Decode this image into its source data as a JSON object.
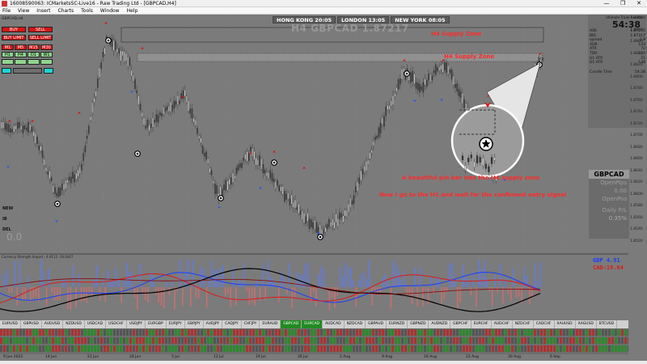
{
  "window": {
    "title": "16008590063: ICMarketsSC-Live16 - Raw Trading Ltd - [GBPCAD,H4]",
    "controls": [
      "—",
      "❐",
      "✕"
    ]
  },
  "menu": [
    "File",
    "View",
    "Insert",
    "Charts",
    "Tools",
    "Window",
    "Help"
  ],
  "chart": {
    "symbol_tf": "GBPCAD,H4",
    "watermark": "H4 GBPCAD 1.87217",
    "sessions": [
      {
        "label": "HONG KONG 20:05"
      },
      {
        "label": "LONDON 13:05"
      },
      {
        "label": "NEW YORK 08:05"
      }
    ],
    "annotations": {
      "zone_top": "H4 Supply Zone",
      "zone_mid": "H4 Supply Zone",
      "pin_bar": "A beautiful pin bar into the H4 supply zone",
      "next_step": "Now I go to the H1 and wait for the confirmed entry signal"
    },
    "price_axis": [
      "1.8900",
      "1.8880",
      "1.8860",
      "1.8840",
      "1.8820",
      "1.8800",
      "1.8780",
      "1.8760",
      "1.8740",
      "1.8720",
      "1.8700",
      "1.8680",
      "1.8660",
      "1.8640",
      "1.8620",
      "1.8600",
      "1.8580",
      "1.8560",
      "1.8540",
      "1.8520"
    ],
    "left_value": "0.0",
    "left_labels": [
      "NEW",
      "IB",
      "DEL"
    ]
  },
  "left_panel": {
    "rows": [
      [
        "BUY",
        "SELL"
      ],
      [
        "BUY LIMIT",
        "SELL LIMIT"
      ],
      [
        "M1",
        "M5",
        "M15",
        "M30"
      ],
      [
        "H1",
        "H4",
        "D1",
        "W1"
      ]
    ]
  },
  "right_panel": {
    "title": "Ultimate Trade Assistant",
    "timer": "54:38",
    "rows": [
      [
        "ASK",
        "1.87245"
      ],
      [
        "BID",
        "1.87217"
      ],
      [
        "spread",
        "2.8"
      ],
      [
        "ADR",
        "143"
      ],
      [
        "ATR",
        "72"
      ],
      [
        "TDR",
        "134"
      ],
      [
        "H1 ATR",
        "21"
      ],
      [
        "D1 ATR",
        "148"
      ]
    ],
    "candle_time_label": "Candle Time",
    "candle_time": "54:38"
  },
  "symbol_box": {
    "name": "GBPCAD",
    "lines": [
      "OpenPips",
      "0.00",
      "OpenPos",
      "Daily P/L",
      "0.35%"
    ]
  },
  "indicator": {
    "header": "Currency Strength Import - 4.9112 -19.6447",
    "gbp": "GBP  4.91",
    "cad": "CAD-19.64"
  },
  "tabs": [
    "EURUSD",
    "GBPUSD",
    "AUDUSD",
    "NZDUSD",
    "USDCAD",
    "USDCHF",
    "USDJPY",
    "EURGBP",
    "EURJPY",
    "GBPJPY",
    "AUDJPY",
    "CADJPY",
    "CHFJPY",
    "EURAUD",
    "GBPCAD",
    "EURCAD",
    "AUDCAD",
    "NZDCAD",
    "GBPAUD",
    "EURNZD",
    "GBPNZD",
    "AUDNZD",
    "GBPCHF",
    "EURCHF",
    "AUDCHF",
    "NZDCHF",
    "CADCHF",
    "XAUUSD",
    "XAGUSD",
    "BTCUSD"
  ],
  "selected_tabs": [
    "GBPCAD",
    "EURCAD"
  ],
  "time_axis": [
    "9 Jun 2022",
    "14 Jun",
    "21 Jun",
    "28 Jun",
    "5 Jul",
    "12 Jul",
    "19 Jul",
    "26 Jul",
    "2 Aug",
    "9 Aug",
    "16 Aug",
    "23 Aug",
    "30 Aug",
    "6 Sep"
  ]
}
